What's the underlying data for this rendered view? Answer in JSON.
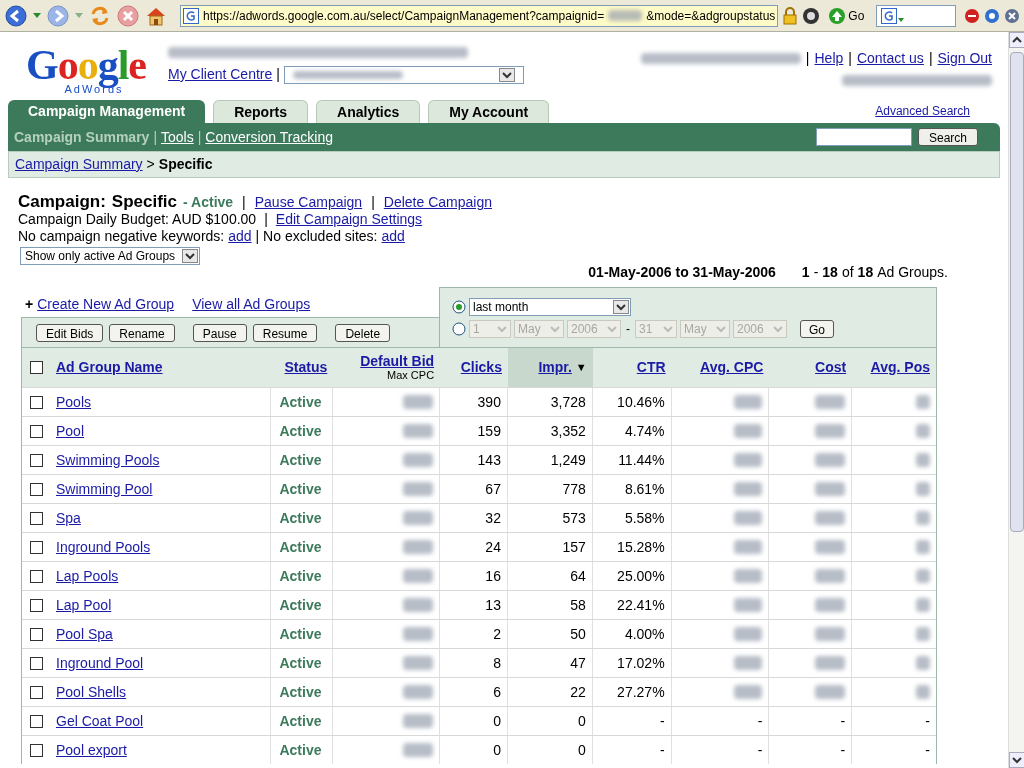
{
  "browser": {
    "url_start": "https://adwords.google.com.au/select/CampaignManagement?campaignid=",
    "url_end": "&mode=&adgroupstatus",
    "go": "Go"
  },
  "logo": {
    "word": "Google",
    "sub": "AdWords"
  },
  "separator": "|",
  "header": {
    "client_centre": "My Client Centre",
    "links": [
      "Help",
      "Contact us",
      "Sign Out"
    ]
  },
  "tabs": [
    {
      "label": "Campaign Management",
      "selected": true
    },
    {
      "label": "Reports",
      "selected": false
    },
    {
      "label": "Analytics",
      "selected": false
    },
    {
      "label": "My Account",
      "selected": false
    }
  ],
  "advanced_search": "Advanced Search",
  "subnav": [
    {
      "label": "Campaign Summary",
      "selected": true
    },
    {
      "label": "Tools",
      "selected": false
    },
    {
      "label": "Conversion Tracking",
      "selected": false
    }
  ],
  "search_button": "Search",
  "breadcrumb": {
    "link": "Campaign Summary",
    "sep": ">",
    "current": "Specific"
  },
  "campaign": {
    "label": "Campaign:",
    "name": "Specific",
    "status": "- Active",
    "actions": [
      "Pause Campaign",
      "Delete Campaign"
    ],
    "budget": "Campaign Daily Budget: AUD $100.00",
    "edit": "Edit Campaign Settings",
    "neg_text": "No campaign negative keywords:",
    "neg_link": "add",
    "excl_text": "| No excluded sites:",
    "excl_link": "add"
  },
  "filter": "Show only active Ad Groups",
  "range": {
    "dates": "01-May-2006 to 31-May-2006",
    "from": "1",
    "dash": "-",
    "to": "18",
    "of": "of",
    "total": "18",
    "unit": "Ad Groups."
  },
  "links": [
    "Create New Ad Group",
    "View all Ad Groups"
  ],
  "create_mark": "+",
  "buttons": [
    "Edit Bids",
    "Rename",
    "Pause",
    "Resume",
    "Delete"
  ],
  "date_picker": {
    "preset": {
      "value": "last month",
      "selected": true
    },
    "custom": {
      "selected": false,
      "from": [
        "1",
        "May",
        "2006"
      ],
      "dash": "-",
      "to": [
        "31",
        "May",
        "2006"
      ]
    },
    "go": "Go"
  },
  "columns": [
    {
      "label": "Ad Group Name",
      "sorted": false
    },
    {
      "label": "Status",
      "sorted": false
    },
    {
      "label": "Default Bid",
      "sub": "Max CPC",
      "sorted": false
    },
    {
      "label": "Clicks",
      "sorted": false
    },
    {
      "label": "Impr.",
      "sorted": true,
      "arrow": "▼"
    },
    {
      "label": "CTR",
      "sorted": false
    },
    {
      "label": "Avg. CPC",
      "sorted": false
    },
    {
      "label": "Cost",
      "sorted": false
    },
    {
      "label": "Avg. Pos",
      "sorted": false
    }
  ],
  "rows": [
    {
      "name": "Pools",
      "status": "Active",
      "clicks": "390",
      "impr": "3,728",
      "ctr": "10.46%",
      "checked": false
    },
    {
      "name": "Pool",
      "status": "Active",
      "clicks": "159",
      "impr": "3,352",
      "ctr": "4.74%",
      "checked": false
    },
    {
      "name": "Swimming Pools",
      "status": "Active",
      "clicks": "143",
      "impr": "1,249",
      "ctr": "11.44%",
      "checked": false
    },
    {
      "name": "Swimming Pool",
      "status": "Active",
      "clicks": "67",
      "impr": "778",
      "ctr": "8.61%",
      "checked": false
    },
    {
      "name": "Spa",
      "status": "Active",
      "clicks": "32",
      "impr": "573",
      "ctr": "5.58%",
      "checked": false
    },
    {
      "name": "Inground Pools",
      "status": "Active",
      "clicks": "24",
      "impr": "157",
      "ctr": "15.28%",
      "checked": false
    },
    {
      "name": "Lap Pools",
      "status": "Active",
      "clicks": "16",
      "impr": "64",
      "ctr": "25.00%",
      "checked": false
    },
    {
      "name": "Lap Pool",
      "status": "Active",
      "clicks": "13",
      "impr": "58",
      "ctr": "22.41%",
      "checked": false
    },
    {
      "name": "Pool Spa",
      "status": "Active",
      "clicks": "2",
      "impr": "50",
      "ctr": "4.00%",
      "checked": false
    },
    {
      "name": "Inground Pool",
      "status": "Active",
      "clicks": "8",
      "impr": "47",
      "ctr": "17.02%",
      "checked": false
    },
    {
      "name": "Pool Shells",
      "status": "Active",
      "clicks": "6",
      "impr": "22",
      "ctr": "27.27%",
      "checked": false
    },
    {
      "name": "Gel Coat Pool",
      "status": "Active",
      "clicks": "0",
      "impr": "0",
      "ctr": "-",
      "avg_cpc": "-",
      "cost": "-",
      "avg_pos": "-",
      "checked": false
    },
    {
      "name": "Pool export",
      "status": "Active",
      "clicks": "0",
      "impr": "0",
      "ctr": "-",
      "avg_cpc": "-",
      "cost": "-",
      "avg_pos": "-",
      "checked": false
    }
  ]
}
